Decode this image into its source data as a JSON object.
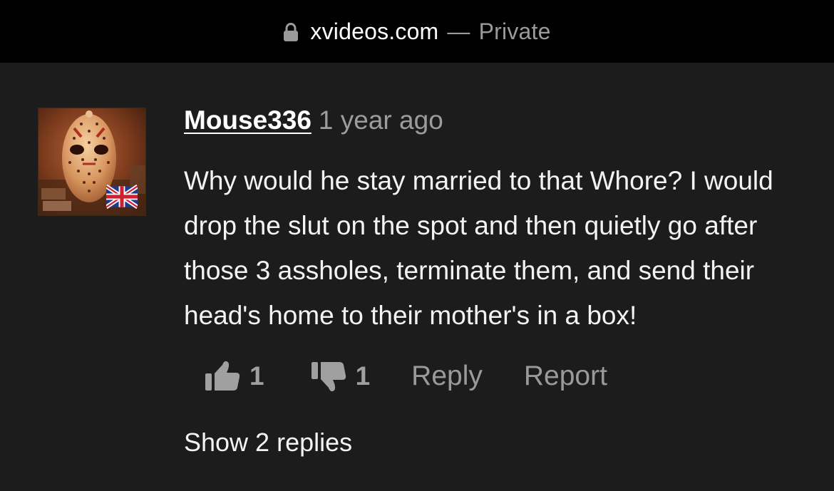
{
  "browser": {
    "domain": "xvideos.com",
    "separator": "—",
    "mode": "Private",
    "lock_icon": "lock-icon"
  },
  "comment": {
    "avatar_icon": "hockey-mask-avatar",
    "country_flag_icon": "uk-flag-icon",
    "username": "Mouse336",
    "timestamp": "1 year ago",
    "text": "Why would he stay married to that Whore? I would drop the slut on the spot and then quietly go after those 3 assholes, terminate them, and send their head's home to their mother's in a box!",
    "upvote_icon": "thumbs-up-icon",
    "upvotes": "1",
    "downvote_icon": "thumbs-down-icon",
    "downvotes": "1",
    "reply_label": "Reply",
    "report_label": "Report",
    "show_replies_label": "Show 2 replies"
  },
  "colors": {
    "background": "#1c1c1c",
    "topbar": "#000000",
    "text": "#f3f3f3",
    "muted": "#9a9a9a"
  }
}
